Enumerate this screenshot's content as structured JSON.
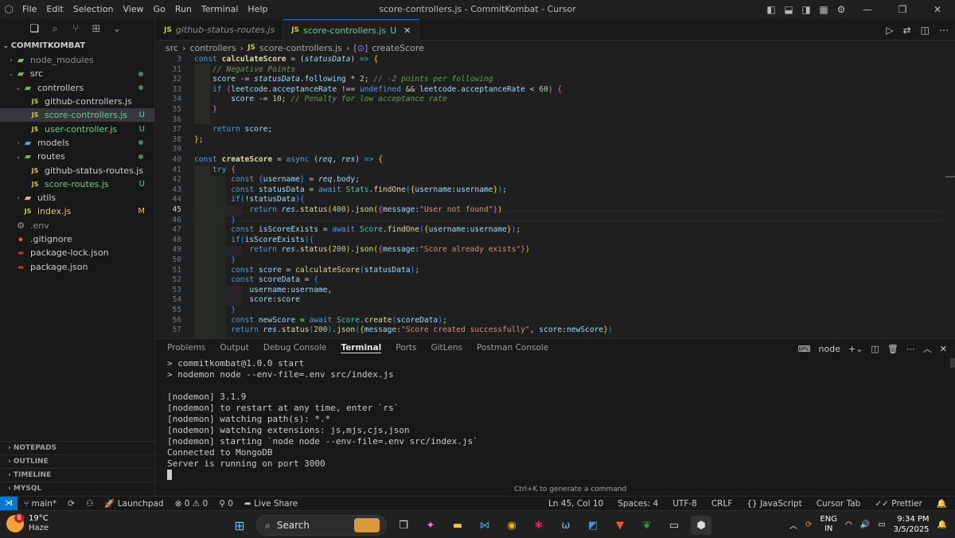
{
  "window": {
    "title": "score-controllers.js - CommitKombat - Cursor",
    "menu": [
      "File",
      "Edit",
      "Selection",
      "View",
      "Go",
      "Run",
      "Terminal",
      "Help"
    ]
  },
  "explorer": {
    "header": "COMMITKOMBAT",
    "items": [
      {
        "label": "node_modules",
        "indent": 1,
        "type": "folder",
        "chev": "›",
        "muted": true,
        "badge": "",
        "dot": false
      },
      {
        "label": "src",
        "indent": 1,
        "type": "folder",
        "chev": "⌄",
        "muted": false,
        "badge": "",
        "dot": true
      },
      {
        "label": "controllers",
        "indent": 2,
        "type": "folder",
        "chev": "⌄",
        "muted": false,
        "badge": "",
        "dot": true
      },
      {
        "label": "github-controllers.js",
        "indent": 3,
        "type": "js",
        "chev": "",
        "muted": false,
        "badge": "",
        "dot": false
      },
      {
        "label": "score-controllers.js",
        "indent": 3,
        "type": "js",
        "chev": "",
        "muted": false,
        "badge": "U",
        "dot": false,
        "selected": true
      },
      {
        "label": "user-controller.js",
        "indent": 3,
        "type": "js",
        "chev": "",
        "muted": false,
        "badge": "U",
        "dot": false
      },
      {
        "label": "models",
        "indent": 2,
        "type": "folder",
        "chev": "›",
        "muted": false,
        "badge": "",
        "dot": true
      },
      {
        "label": "routes",
        "indent": 2,
        "type": "folder",
        "chev": "⌄",
        "muted": false,
        "badge": "",
        "dot": true
      },
      {
        "label": "github-status-routes.js",
        "indent": 3,
        "type": "js",
        "chev": "",
        "muted": false,
        "badge": "",
        "dot": false
      },
      {
        "label": "score-routes.js",
        "indent": 3,
        "type": "js",
        "chev": "",
        "muted": false,
        "badge": "U",
        "dot": false
      },
      {
        "label": "utils",
        "indent": 2,
        "type": "folder",
        "chev": "›",
        "muted": false,
        "badge": "",
        "dot": false
      },
      {
        "label": "index.js",
        "indent": 2,
        "type": "js",
        "chev": "",
        "muted": false,
        "badge": "M",
        "dot": false
      },
      {
        "label": ".env",
        "indent": 1,
        "type": "gear",
        "chev": "",
        "muted": true,
        "badge": "",
        "dot": false
      },
      {
        "label": ".gitignore",
        "indent": 1,
        "type": "git",
        "chev": "",
        "muted": false,
        "badge": "",
        "dot": false
      },
      {
        "label": "package-lock.json",
        "indent": 1,
        "type": "npm",
        "chev": "",
        "muted": false,
        "badge": "",
        "dot": false
      },
      {
        "label": "package.json",
        "indent": 1,
        "type": "npm",
        "chev": "",
        "muted": false,
        "badge": "",
        "dot": false
      }
    ],
    "sections": [
      "NOTEPADS",
      "OUTLINE",
      "TIMELINE",
      "MYSQL"
    ]
  },
  "tabs": [
    {
      "label": "github-status-routes.js",
      "active": false,
      "badge": "JS",
      "mod": ""
    },
    {
      "label": "score-controllers.js",
      "active": true,
      "badge": "JS",
      "mod": "U"
    }
  ],
  "breadcrumb": [
    "src",
    "controllers",
    "score-controllers.js",
    "createScore"
  ],
  "editor": {
    "line_numbers": [
      "3",
      "31",
      "32",
      "33",
      "34",
      "35",
      "36",
      "37",
      "38",
      "39",
      "40",
      "41",
      "42",
      "43",
      "44",
      "45",
      "46",
      "47",
      "48",
      "49",
      "50",
      "51",
      "52",
      "53",
      "54",
      "55",
      "56",
      "57"
    ],
    "current_line": "45"
  },
  "panel": {
    "tabs": [
      "Problems",
      "Output",
      "Debug Console",
      "Terminal",
      "Ports",
      "GitLens",
      "Postman Console"
    ],
    "active_tab": "Terminal",
    "shell": "node",
    "terminal_lines": [
      "> commitkombat@1.0.0 start",
      "> nodemon node --env-file=.env src/index.js",
      "",
      "[nodemon] 3.1.9",
      "[nodemon] to restart at any time, enter `rs`",
      "[nodemon] watching path(s): *.*",
      "[nodemon] watching extensions: js,mjs,cjs,json",
      "[nodemon] starting `node node --env-file=.env src/index.js`",
      "Connected to MongoDB",
      "Server is running on port 3000"
    ],
    "hint": "Ctrl+K to generate a command"
  },
  "statusbar": {
    "branch": "main*",
    "launchpad": "Launchpad",
    "errors": "0",
    "warnings": "0",
    "ports": "0",
    "liveshare": "Live Share",
    "position": "Ln 45, Col 10",
    "spaces": "Spaces: 4",
    "encoding": "UTF-8",
    "eol": "CRLF",
    "language": "JavaScript",
    "cursortab": "Cursor Tab",
    "prettier": "Prettier"
  },
  "taskbar": {
    "temp": "19°C",
    "weather": "Haze",
    "weather_badge": "8",
    "search": "Search",
    "lang": "ENG",
    "region": "IN",
    "time": "9:34 PM",
    "date": "3/5/2025"
  },
  "colors": {
    "accent": "#0078d4",
    "editor_bg": "#1f1f1f",
    "sidebar_bg": "#181818"
  }
}
